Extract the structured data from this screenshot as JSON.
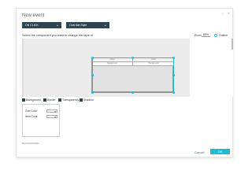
{
  "window": {
    "title": "New event",
    "restore_icon": "▫",
    "close_icon": "×"
  },
  "dropdowns": {
    "event_label": "ON CLICK",
    "action_label": "Override Style"
  },
  "instruction": "Select the component you want to change the style of",
  "zoom": {
    "label": "Zoom",
    "value": "86%"
  },
  "outline": {
    "label": "Outline"
  },
  "preview_table": {
    "header_cells": [
      "Label",
      "Label"
    ],
    "second_row_cells": [
      "Background",
      "Background"
    ]
  },
  "style_checks": [
    {
      "label": "Background"
    },
    {
      "label": "Border"
    },
    {
      "label": "Transparency"
    },
    {
      "label": "Shadow"
    }
  ],
  "properties": {
    "row1_label": "Grid Color",
    "row2_label": "Item Color"
  },
  "footer_text": "BACKGROUND",
  "buttons": {
    "cancel": "Cancel",
    "ok": "OK"
  },
  "colors": {
    "accent": "#1fbcd2",
    "dark": "#2f4554"
  }
}
